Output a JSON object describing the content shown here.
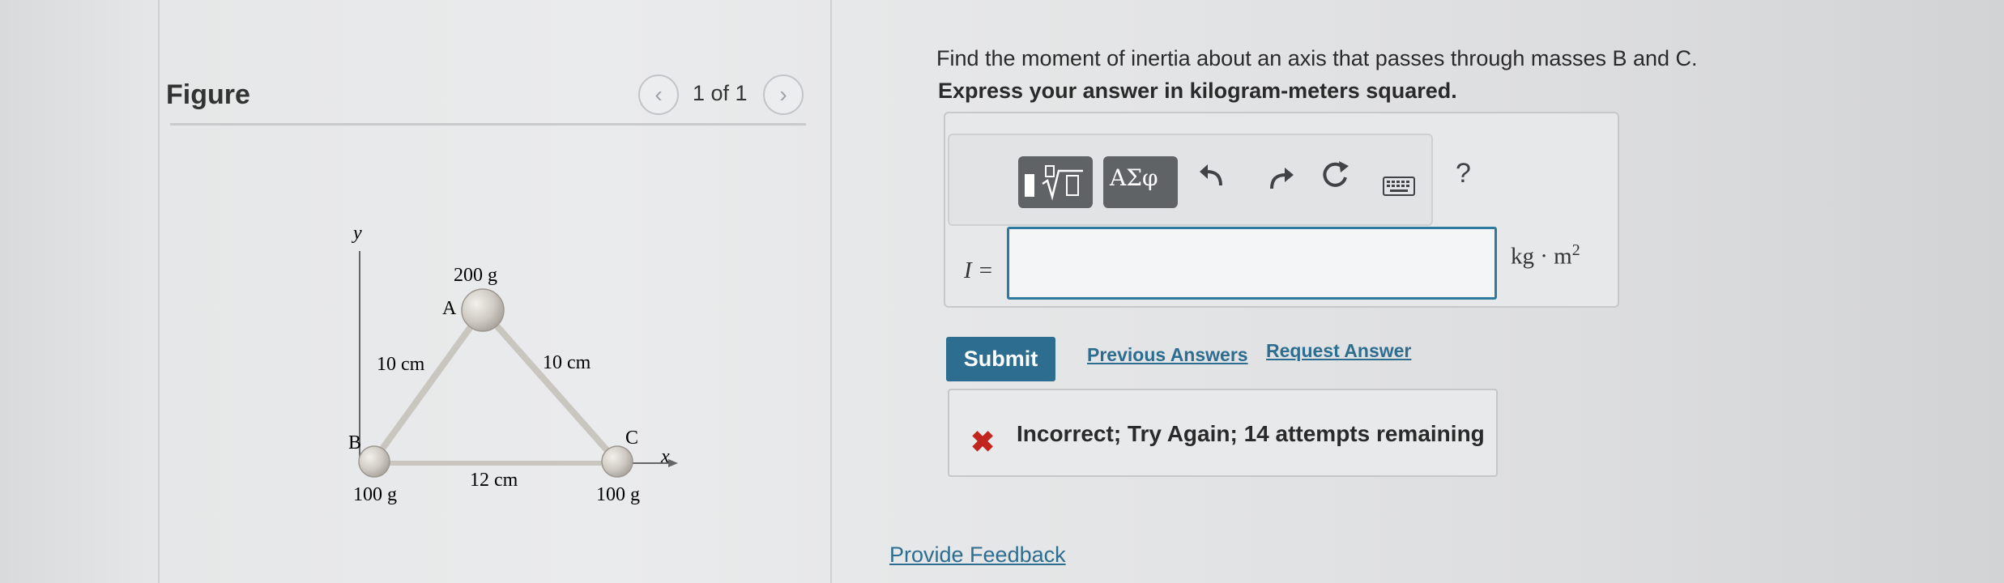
{
  "figure_panel": {
    "title": "Figure",
    "pager": "1 of 1",
    "diagram": {
      "axis_y": "y",
      "axis_x": "x",
      "mass_a_label": "A",
      "mass_a_value": "200 g",
      "mass_b_label": "B",
      "mass_b_value": "100 g",
      "mass_c_label": "C",
      "mass_c_value": "100 g",
      "side_ab": "10 cm",
      "side_ac": "10 cm",
      "side_bc": "12 cm"
    }
  },
  "question": {
    "prompt": "Find the moment of inertia about an axis that passes through masses B and C.",
    "instruction": "Express your answer in kilogram-meters squared."
  },
  "toolbar": {
    "templates_icon": "fraction-radical-icon",
    "greek_label": "ΑΣφ",
    "undo_icon": "undo-icon",
    "redo_icon": "redo-icon",
    "reset_icon": "reset-icon",
    "keyboard_icon": "keyboard-icon",
    "help_label": "?"
  },
  "answer": {
    "label": "I =",
    "value": "",
    "unit": "kg · m",
    "unit_exponent": "2"
  },
  "actions": {
    "submit_label": "Submit",
    "previous_answers_label": "Previous Answers",
    "request_answer_label": "Request Answer"
  },
  "feedback": {
    "icon": "x-mark-icon",
    "message": "Incorrect; Try Again; 14 attempts remaining",
    "color": "#c0261e"
  },
  "footer": {
    "provide_feedback_label": "Provide Feedback"
  },
  "colors": {
    "accent": "#2c6d90",
    "error": "#c0261e"
  }
}
